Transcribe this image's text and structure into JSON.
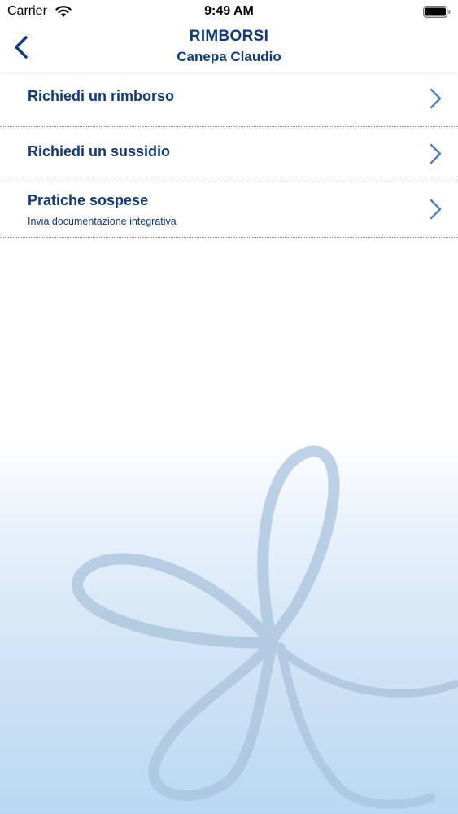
{
  "status_bar": {
    "carrier": "Carrier",
    "time": "9:49 AM"
  },
  "nav": {
    "title": "RIMBORSI",
    "subtitle": "Canepa Claudio",
    "back_icon": "chevron-left-icon"
  },
  "menu": {
    "items": [
      {
        "label": "Richiedi un rimborso",
        "sub": ""
      },
      {
        "label": "Richiedi un sussidio",
        "sub": ""
      },
      {
        "label": "Pratiche sospese",
        "sub": "Invia documentazione integrativa"
      }
    ]
  },
  "colors": {
    "brand_blue": "#0f3a7d",
    "chevron_blue": "#4d7fc0",
    "background_bottom": "#b9d9f2"
  }
}
